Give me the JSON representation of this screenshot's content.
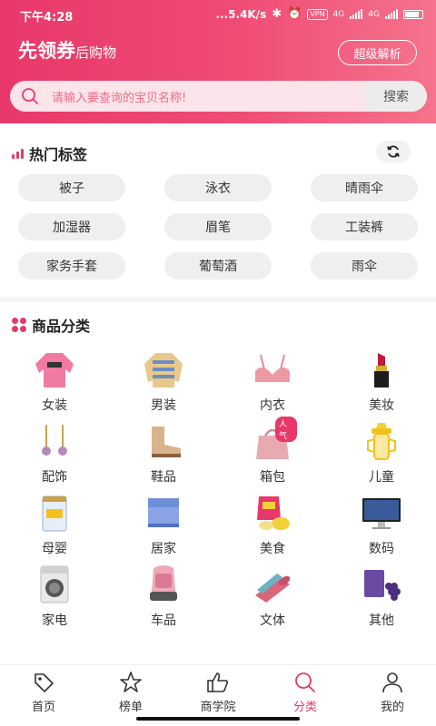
{
  "status_bar": {
    "time": "下午4:28",
    "speed": "...5.4K/s",
    "vpn": "VPN",
    "net1": "4G",
    "net2": "4G"
  },
  "brand": {
    "title": "先领券",
    "subtitle": "后购物"
  },
  "header": {
    "super_button": "超级解析"
  },
  "search": {
    "placeholder": "请输入要查询的宝贝名称!",
    "button": "搜索"
  },
  "hot_tags": {
    "title": "热门标签",
    "items": [
      "被子",
      "泳衣",
      "晴雨伞",
      "加湿器",
      "眉笔",
      "工装裤",
      "家务手套",
      "葡萄酒",
      "雨伞"
    ]
  },
  "categories": {
    "title": "商品分类",
    "badge": "人气",
    "items": [
      {
        "label": "女装",
        "icon": "pink-sweater-icon"
      },
      {
        "label": "男装",
        "icon": "striped-sweater-icon"
      },
      {
        "label": "内衣",
        "icon": "bra-icon"
      },
      {
        "label": "美妆",
        "icon": "lipstick-icon"
      },
      {
        "label": "配饰",
        "icon": "earrings-icon"
      },
      {
        "label": "鞋品",
        "icon": "boots-icon"
      },
      {
        "label": "箱包",
        "icon": "handbag-icon"
      },
      {
        "label": "儿童",
        "icon": "baby-bottle-icon"
      },
      {
        "label": "母婴",
        "icon": "milk-powder-icon"
      },
      {
        "label": "居家",
        "icon": "bedding-icon"
      },
      {
        "label": "美食",
        "icon": "snack-bag-icon"
      },
      {
        "label": "数码",
        "icon": "monitor-icon"
      },
      {
        "label": "家电",
        "icon": "washing-machine-icon"
      },
      {
        "label": "车品",
        "icon": "car-seat-icon"
      },
      {
        "label": "文体",
        "icon": "yoga-mat-icon"
      },
      {
        "label": "其他",
        "icon": "grape-box-icon"
      }
    ]
  },
  "tabbar": {
    "items": [
      {
        "label": "首页",
        "icon": "tag-icon"
      },
      {
        "label": "榜单",
        "icon": "star-icon"
      },
      {
        "label": "商学院",
        "icon": "thumbs-up-icon"
      },
      {
        "label": "分类",
        "icon": "search-icon",
        "active": true
      },
      {
        "label": "我的",
        "icon": "person-icon"
      }
    ]
  },
  "colors": {
    "accent": "#e8386a",
    "header_end": "#f5738d",
    "tag_bg": "#efefef"
  }
}
